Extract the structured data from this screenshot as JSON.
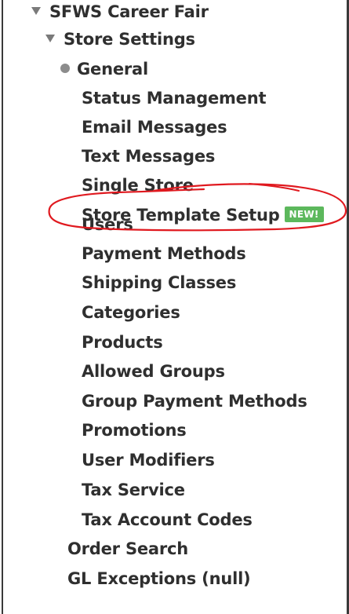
{
  "tree": {
    "items": [
      {
        "label": "SFWS Career Fair",
        "marker": "triangle-down"
      },
      {
        "label": "Store Settings",
        "marker": "triangle-down"
      },
      {
        "label": "General",
        "marker": "bullet"
      },
      {
        "label": "Status Management"
      },
      {
        "label": "Email Messages"
      },
      {
        "label": "Text Messages"
      },
      {
        "label": "Single Store"
      },
      {
        "label": "Store Template Setup",
        "badge": "NEW!"
      },
      {
        "label": "Users"
      },
      {
        "label": "Payment Methods"
      },
      {
        "label": "Shipping Classes"
      },
      {
        "label": "Categories"
      },
      {
        "label": "Products"
      },
      {
        "label": "Allowed Groups"
      },
      {
        "label": "Group Payment Methods"
      },
      {
        "label": "Promotions"
      },
      {
        "label": "User Modifiers"
      },
      {
        "label": "Tax Service"
      },
      {
        "label": "Tax Account Codes"
      },
      {
        "label": "Order Search"
      },
      {
        "label": "GL Exceptions (null)"
      }
    ]
  },
  "colors": {
    "badge": "#5cb85c",
    "annotation": "#e0191f",
    "text": "#2f2f2f"
  },
  "icons": [
    "triangle-down-icon",
    "bullet-icon"
  ]
}
